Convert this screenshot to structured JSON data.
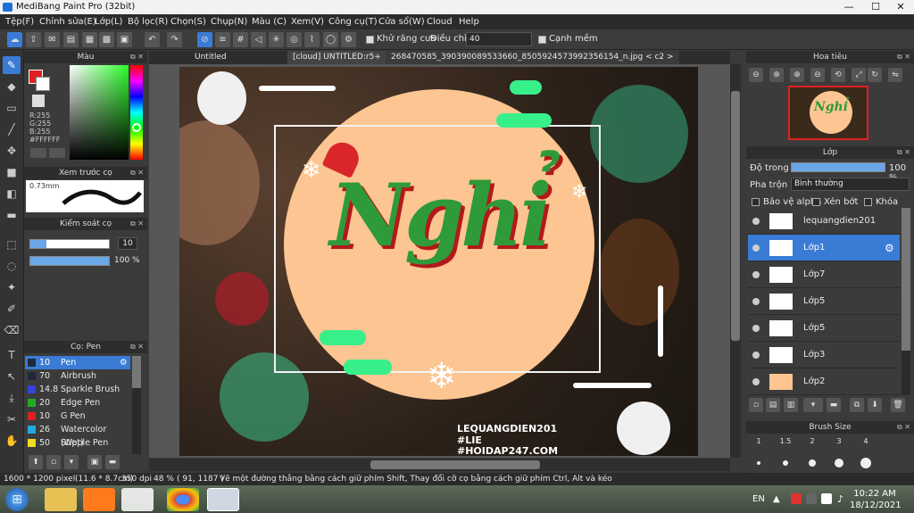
{
  "app": {
    "title": "MediBang Paint Pro (32bit)"
  },
  "menu": [
    "Tệp(F)",
    "Chỉnh sửa(E)",
    "Lớp(L)",
    "Bộ lọc(R)",
    "Chọn(S)",
    "Chụp(N)",
    "Màu (C)",
    "Xem(V)",
    "Công cụ(T)",
    "Cửa sổ(W)",
    "Cloud",
    "Help"
  ],
  "toolbar": {
    "antialias_label": "Khử răng cưa",
    "adjust_label": "Điều chỉnh",
    "adjust_value": "40",
    "sharp_label": "Cạnh mềm"
  },
  "color_panel": {
    "title": "Màu",
    "r": "R:255",
    "g": "G:255",
    "b": "B:255",
    "hex": "#FFFFFF"
  },
  "preview_panel": {
    "title": "Xem trước cọ",
    "size": "0.73mm"
  },
  "control_panel": {
    "title": "Kiểm soát cọ",
    "size_value": "10",
    "opacity_value": "100 %"
  },
  "brush_panel": {
    "title": "Cọ: Pen",
    "items": [
      {
        "size": "10",
        "name": "Pen",
        "color": "#1e2a3a"
      },
      {
        "size": "70",
        "name": "Airbrush",
        "color": "#1e2a3a"
      },
      {
        "size": "14.8",
        "name": "Sparkle Brush",
        "color": "#3344dd"
      },
      {
        "size": "20",
        "name": "Edge Pen",
        "color": "#22aa22"
      },
      {
        "size": "10",
        "name": "G Pen",
        "color": "#dd2222"
      },
      {
        "size": "26",
        "name": "Watercolor (Wet)",
        "color": "#22aadd"
      },
      {
        "size": "50",
        "name": "Stipple Pen",
        "color": "#eedd22"
      }
    ]
  },
  "tabs": [
    "Untitled",
    "[cloud] UNTITLED:r5+",
    "268470585_390390089533660_8505924573992356154_n.jpg < c2 >"
  ],
  "artwork": {
    "word": "Nghỉ",
    "sig1": "LEQUANGDIEN201",
    "sig2": "#LIE",
    "sig3": "#HOIDAP247.COM"
  },
  "navigator": {
    "title": "Hoa tiêu",
    "thumb_text": "Nghỉ"
  },
  "layer_panel": {
    "title": "Lớp",
    "opacity_label": "Độ trong",
    "opacity_value": "100 %",
    "blend_label": "Pha trộn",
    "blend_value": "Bình thường",
    "protect_alpha": "Bảo vệ alpha",
    "clipping": "Xén bớt",
    "lock": "Khóa",
    "layers": [
      "lequangdien201",
      "Lớp1",
      "Lớp7",
      "Lớp5",
      "Lớp5",
      "Lớp3",
      "Lớp2"
    ],
    "selected_index": 1
  },
  "brush_size": {
    "title": "Brush Size",
    "sizes": [
      "1",
      "1.5",
      "2",
      "3",
      "4"
    ]
  },
  "status": {
    "dims": "1600 * 1200 pixel",
    "cm": "(11.6 * 8.7cm)",
    "dpi": "350 dpi",
    "zoom": "48 %",
    "coords": "( 91, 1187 )",
    "hint": "Vẽ một đường thẳng bằng cách giữ phím Shift, Thay đổi cỡ cọ bằng cách giữ phím Ctrl, Alt và kéo"
  },
  "taskbar": {
    "lang": "EN",
    "time": "10:22 AM",
    "date": "18/12/2021"
  }
}
